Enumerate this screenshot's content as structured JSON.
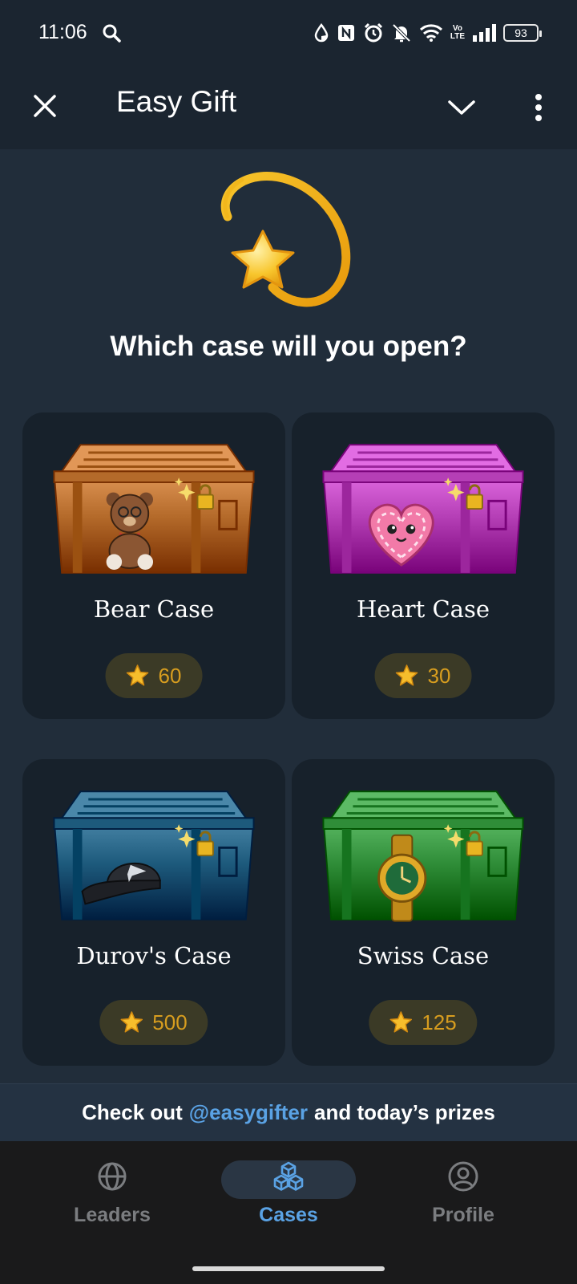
{
  "status_bar": {
    "time": "11:06",
    "battery": "93",
    "network_label": "Vo\nLTE"
  },
  "header": {
    "title": "Easy Gift",
    "icons": [
      "close-icon",
      "chevron-down-icon",
      "more-vertical-icon"
    ]
  },
  "hero": {
    "icon": "shooting-star-icon",
    "headline": "Which case will you open?"
  },
  "cases": [
    {
      "name": "Bear Case",
      "price": "60",
      "color": "#b46a2a",
      "emblem": "teddy-bear"
    },
    {
      "name": "Heart Case",
      "price": "30",
      "color": "#b53fb6",
      "emblem": "heart-cookie"
    },
    {
      "name": "Durov's Case",
      "price": "500",
      "color": "#1d5a7c",
      "emblem": "cap"
    },
    {
      "name": "Swiss Case",
      "price": "125",
      "color": "#2f8d38",
      "emblem": "gold-watch"
    }
  ],
  "promo": {
    "prefix": "Check out",
    "link": "@easygifter",
    "suffix": "and today’s prizes"
  },
  "nav": {
    "items": [
      {
        "label": "Leaders",
        "icon": "globe-icon"
      },
      {
        "label": "Cases",
        "icon": "cubes-icon"
      },
      {
        "label": "Profile",
        "icon": "user-circle-icon"
      }
    ],
    "active": "Cases"
  },
  "colors": {
    "background": "#212d3a",
    "card": "#17212b",
    "accent": "#5aa2e4",
    "price_text": "#d79d1f"
  }
}
